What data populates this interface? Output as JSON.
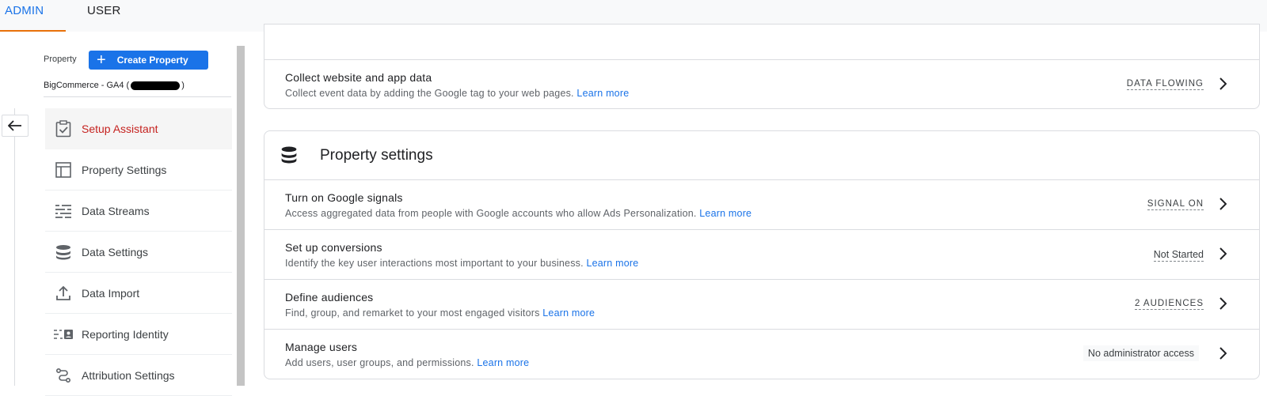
{
  "tabs": {
    "admin": "ADMIN",
    "user": "USER"
  },
  "sidebar": {
    "property_label": "Property",
    "create_button": "Create Property",
    "property_name_prefix": "BigCommerce - GA4 (",
    "property_name_suffix": ")",
    "items": [
      {
        "label": "Setup Assistant",
        "icon": "checklist-icon",
        "active": true
      },
      {
        "label": "Property Settings",
        "icon": "layout-icon"
      },
      {
        "label": "Data Streams",
        "icon": "streams-icon"
      },
      {
        "label": "Data Settings",
        "icon": "database-icon"
      },
      {
        "label": "Data Import",
        "icon": "upload-icon"
      },
      {
        "label": "Reporting Identity",
        "icon": "identity-icon"
      },
      {
        "label": "Attribution Settings",
        "icon": "attribution-icon"
      }
    ]
  },
  "collect": {
    "title": "Collect website and app data",
    "desc": "Collect event data by adding the Google tag to your web pages.",
    "learn_more": "Learn more",
    "status": "DATA FLOWING"
  },
  "property_settings": {
    "title": "Property settings",
    "rows": [
      {
        "title": "Turn on Google signals",
        "desc": "Access aggregated data from people with Google accounts who allow Ads Personalization.",
        "learn_more": "Learn more",
        "status": "SIGNAL ON"
      },
      {
        "title": "Set up conversions",
        "desc": "Identify the key user interactions most important to your business.",
        "learn_more": "Learn more",
        "status": "Not Started"
      },
      {
        "title": "Define audiences",
        "desc": "Find, group, and remarket to your most engaged visitors",
        "learn_more": "Learn more",
        "status": "2 AUDIENCES"
      },
      {
        "title": "Manage users",
        "desc": "Add users, user groups, and permissions.",
        "learn_more": "Learn more",
        "status": "No administrator access"
      }
    ]
  },
  "colors": {
    "accent": "#1a73e8",
    "active_text": "#c5221f",
    "tab_underline": "#e8710a"
  }
}
